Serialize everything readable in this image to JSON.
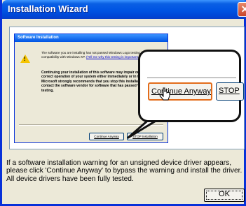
{
  "window": {
    "title": "Installation Wizard",
    "close_glyph": "✕"
  },
  "dialog": {
    "title": "Software Installation",
    "icon": "warning-icon",
    "message": "The software you are installing has not passed Windows Logo testing to verify its compatibility with Windows XP.",
    "link_text": "(Tell me why this testing is important.)",
    "bold_message": "Continuing your installation of this software may impair or destabilize the correct operation of your system either immediately or in the future. Microsoft strongly recommends that you stop this installation now and contact the software vendor for software that has passed Windows Logo testing.",
    "continue_label": "Continue Anyway",
    "stop_label": "STOP Installation"
  },
  "callout": {
    "continue_label": "Continue Anyway",
    "stop_label": "STOP"
  },
  "footer": {
    "text": "If a software installation warning for an unsigned device driver appears, please click 'Continue Anyway' to bypass the warning and install the driver. All device drivers have been fully tested.",
    "ok_label": "OK"
  },
  "colors": {
    "title_bar": "#0054e3",
    "window_face": "#ece9d8",
    "focus_ring": "#e36c1a",
    "warning": "#f5c400"
  }
}
